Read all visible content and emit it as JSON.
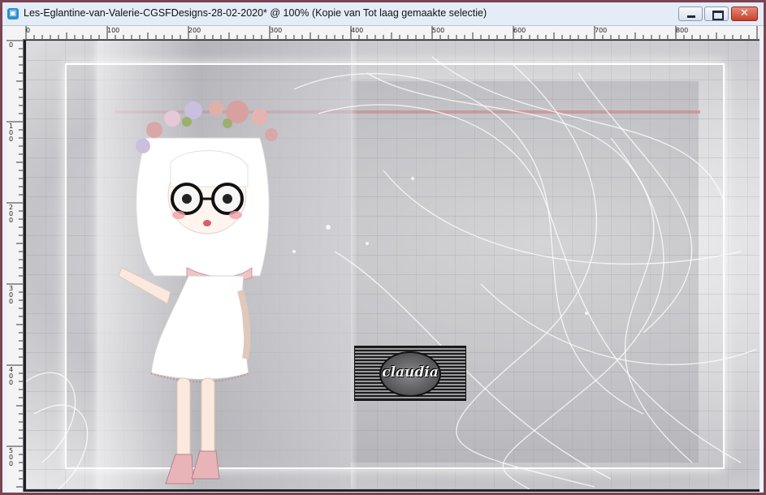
{
  "window": {
    "title": "Les-Eglantine-van-Valerie-CGSFDesigns-28-02-2020* @ 100% (Kopie van Tot laag gemaakte selectie)",
    "app_icon": "paintshop-icon",
    "buttons": {
      "minimize": "minimize-icon",
      "maximize": "maximize-icon",
      "close": "close-icon",
      "close_glyph": "✕"
    }
  },
  "ruler": {
    "h_labels": [
      "0",
      "100",
      "200",
      "300",
      "400",
      "500",
      "600",
      "700",
      "800"
    ],
    "v_labels": [
      "0",
      "100",
      "200",
      "300",
      "400",
      "500"
    ]
  },
  "watermark": {
    "text": "claudia"
  },
  "colors": {
    "frame": "#7a4452",
    "titlebar": "#e4ecf7",
    "accent_pink": "#c98a92"
  }
}
